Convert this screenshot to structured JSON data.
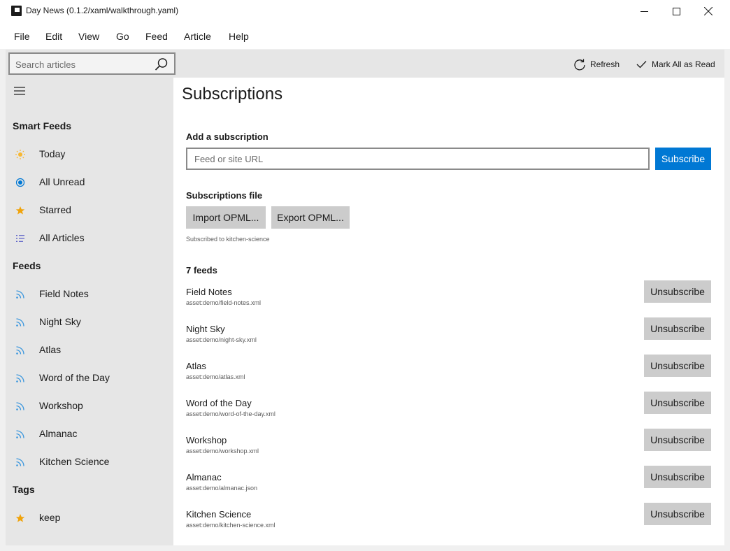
{
  "window": {
    "title": "Day News (0.1.2/xaml/walkthrough.yaml)"
  },
  "menu": [
    "File",
    "Edit",
    "View",
    "Go",
    "Feed",
    "Article",
    "Help"
  ],
  "toolbar": {
    "search_placeholder": "Search articles",
    "refresh_label": "Refresh",
    "mark_all_label": "Mark All as Read"
  },
  "sidebar": {
    "smart_feeds_header": "Smart Feeds",
    "smart_feeds": [
      {
        "label": "Today",
        "icon": "sun-icon"
      },
      {
        "label": "All Unread",
        "icon": "radio-dot-icon"
      },
      {
        "label": "Starred",
        "icon": "star-icon"
      },
      {
        "label": "All Articles",
        "icon": "list-icon"
      }
    ],
    "feeds_header": "Feeds",
    "feeds": [
      {
        "label": "Field Notes",
        "icon": "rss-icon"
      },
      {
        "label": "Night Sky",
        "icon": "rss-icon"
      },
      {
        "label": "Atlas",
        "icon": "rss-icon"
      },
      {
        "label": "Word of the Day",
        "icon": "rss-icon"
      },
      {
        "label": "Workshop",
        "icon": "rss-icon"
      },
      {
        "label": "Almanac",
        "icon": "rss-icon"
      },
      {
        "label": "Kitchen Science",
        "icon": "rss-icon"
      }
    ],
    "tags_header": "Tags",
    "tags": [
      {
        "label": "keep",
        "icon": "star-icon"
      }
    ]
  },
  "main": {
    "title": "Subscriptions",
    "add_label": "Add a subscription",
    "url_placeholder": "Feed or site URL",
    "subscribe_label": "Subscribe",
    "file_label": "Subscriptions file",
    "import_label": "Import OPML...",
    "export_label": "Export OPML...",
    "status": "Subscribed to kitchen-science",
    "feed_count": "7 feeds",
    "unsubscribe_label": "Unsubscribe",
    "feeds": [
      {
        "title": "Field Notes",
        "url": "asset:demo/field-notes.xml"
      },
      {
        "title": "Night Sky",
        "url": "asset:demo/night-sky.xml"
      },
      {
        "title": "Atlas",
        "url": "asset:demo/atlas.xml"
      },
      {
        "title": "Word of the Day",
        "url": "asset:demo/word-of-the-day.xml"
      },
      {
        "title": "Workshop",
        "url": "asset:demo/workshop.xml"
      },
      {
        "title": "Almanac",
        "url": "asset:demo/almanac.json"
      },
      {
        "title": "Kitchen Science",
        "url": "asset:demo/kitchen-science.xml"
      }
    ]
  },
  "colors": {
    "accent": "#0078d4",
    "sun": "#f7b731",
    "star": "#f0a30a",
    "rss": "#3a96dd",
    "list": "#5b5fc7"
  }
}
